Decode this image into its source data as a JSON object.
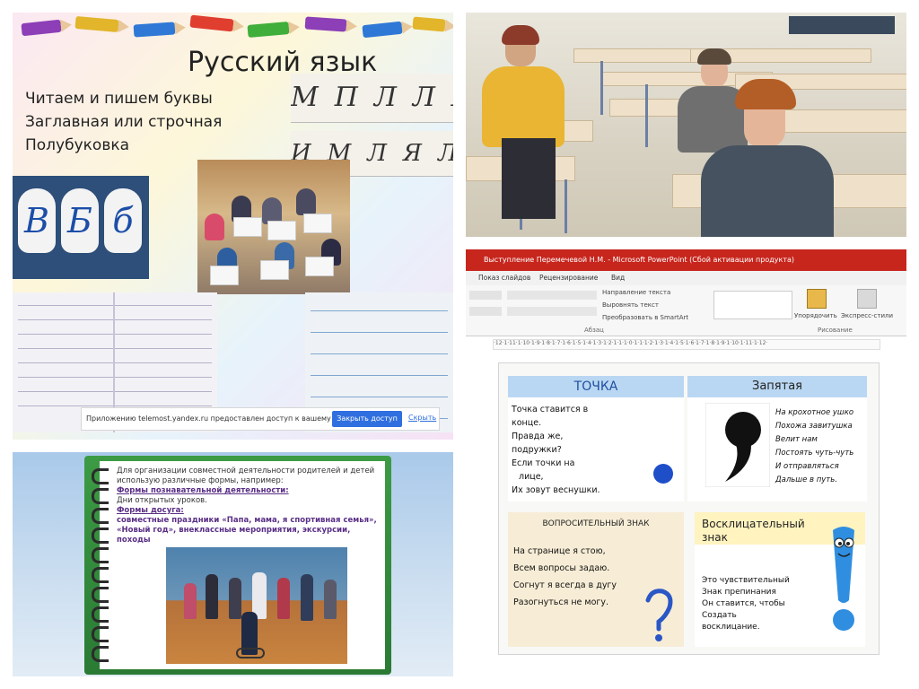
{
  "panel1": {
    "title": "Русский язык",
    "lines": [
      "Читаем и пишем буквы",
      "Заглавная или строчная",
      "Полубуковка"
    ],
    "script_upper": "МПЛЛЯ",
    "script_lower": "ИМЛЯЛ",
    "mitten_letters": [
      "В",
      "Б",
      "б"
    ],
    "notice": {
      "text": "Приложению telemost.yandex.ru предоставлен доступ к вашему экрану.",
      "button": "Закрыть доступ",
      "link": "Скрыть"
    }
  },
  "panel3": {
    "intro": "Для организации совместной деятельности родителей и детей использую различные формы, например:",
    "heading1": "Формы познавательной деятельности:",
    "item1": "Дни открытых уроков.",
    "heading2": "Формы досуга:",
    "item2": "совместные праздники «Папа, мама, я спортивная семья», «Новый год», внеклассные мероприятия, экскурсии, походы"
  },
  "panel4": {
    "window_title": "Выступление Перемечевой Н.М. - Microsoft PowerPoint (Сбой активации продукта)",
    "tabs": [
      "Показ слайдов",
      "Рецензирование",
      "Вид"
    ],
    "ribbon": {
      "text_direction": "Направление текста",
      "align_text": "Выровнять текст",
      "smartart": "Преобразовать в SmartArt",
      "arrange": "Упорядочить",
      "express_styles": "Экспресс-стили",
      "group_paragraph": "Абзац",
      "group_drawing": "Рисование"
    },
    "ruler": "·12·1·11·1·10·1·9·1·8·1·7·1·6·1·5·1·4·1·3·1·2·1·1·1·0·1·1·1·2·1·3·1·4·1·5·1·6·1·7·1·8·1·9·1·10·1·11·1·12·",
    "tochka_title": "ТОЧКА",
    "tochka_poem": [
      "Точка ставится в",
      "конце.",
      "Правда же,",
      "подружки?",
      "Если точки на",
      "лице,",
      "Их зовут веснушки."
    ],
    "zapyataya_title": "Запятая",
    "zapyataya_poem": [
      "На крохотное ушко",
      "Похожа завитушка",
      "Велит нам",
      "Постоять чуть-чуть",
      "И отправляться",
      "Дальше в путь."
    ],
    "vopros_title": "ВОПРОСИТЕЛЬНЫЙ ЗНАК",
    "vopros_poem": [
      "На странице я стою,",
      "Всем вопросы задаю.",
      "Согнут я всегда в дугу",
      "Разогнуться не могу."
    ],
    "vosk_title": "Восклицательный знак",
    "vosk_poem": [
      "Это чувствительный",
      "Знак препинания",
      "Он ставится, чтобы",
      "Создать",
      "восклицание."
    ]
  },
  "colors": {
    "pp_red": "#c7261d",
    "share_button": "#2f6fdf",
    "slide_green": "#2f8a3a",
    "link_purple": "#5a2f86",
    "tochka_blue": "#1f4ea0"
  }
}
